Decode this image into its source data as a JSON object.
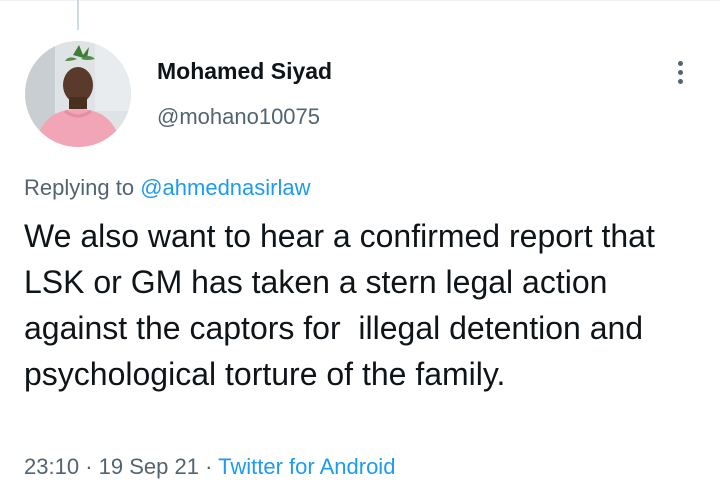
{
  "tweet": {
    "author": {
      "display_name": "Mohamed Siyad",
      "handle": "@mohano10075",
      "avatar_icon": "user-avatar"
    },
    "more_icon": "more-options-icon",
    "replying_prefix": "Replying to",
    "replying_to": "@ahmednasirlaw",
    "text": "We also want to hear a confirmed report that LSK or GM has taken a stern legal action against the captors for  illegal detention and psychological torture of the family.",
    "time": "23:10",
    "separator": "·",
    "date": "19 Sep 21",
    "source": "Twitter for Android"
  },
  "colors": {
    "link": "#1d9bf0",
    "secondary_text": "#536471",
    "primary_text": "#0f1419"
  }
}
